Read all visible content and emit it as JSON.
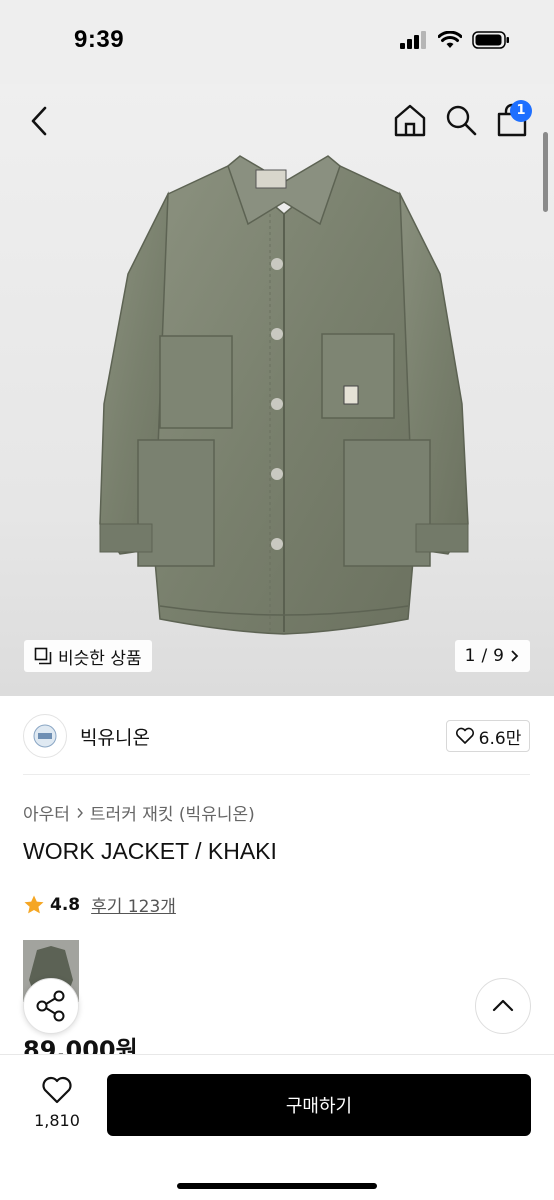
{
  "status": {
    "time": "9:39"
  },
  "nav": {
    "cart_count": "1"
  },
  "hero": {
    "similar_label": "비슷한 상품",
    "page_current": "1",
    "page_separator": "/",
    "page_total": "9"
  },
  "brand": {
    "name": "빅유니온",
    "likes": "6.6만"
  },
  "product": {
    "breadcrumb_category": "아우터",
    "breadcrumb_sub": "트러커 재킷 (빅유니온)",
    "title": "WORK JACKET / KHAKI",
    "rating": "4.8",
    "review_label": "후기 123개",
    "price": "89,000원"
  },
  "bottom": {
    "wish_count": "1,810",
    "buy_label": "구매하기"
  },
  "colors": {
    "accent_blue": "#1e6fff",
    "star": "#f5a623",
    "buy_bg": "#000000",
    "jacket": "#7d8472"
  }
}
